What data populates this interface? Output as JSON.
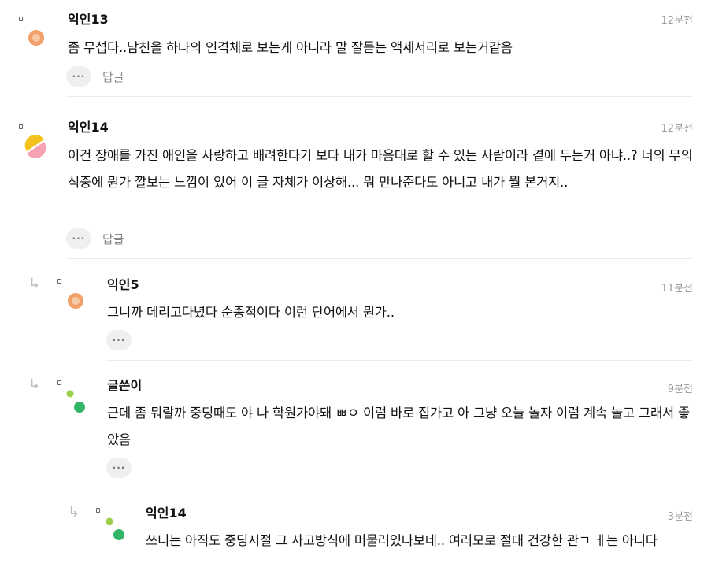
{
  "comments": [
    {
      "author": "익인13",
      "time": "12분전",
      "text": "좀 무섭다..남친을 하나의 인격체로 보는게 아니라 말 잘듣는 액세서리로 보는거같음",
      "reply_label": "답글",
      "more_label": "···",
      "avatar": {
        "type": "ring",
        "colors": [
          "#f2a06a",
          "#f6c9a6"
        ]
      }
    },
    {
      "author": "익인14",
      "time": "12분전",
      "text": "이건 장애를 가진 애인을 사랑하고 배려한다기 보다 내가 마음대로 할 수 있는 사람이라 곁에 두는거 아냐..? 너의 무의식중에 뭔가 깔보는 느낌이 있어 이 글 자체가 이상해... 뭐 만나준다도 아니고 내가 뭘 본거지..",
      "reply_label": "답글",
      "more_label": "···",
      "avatar": {
        "type": "halves",
        "colors": [
          "#f4c21e",
          "#f5a3b4"
        ]
      }
    },
    {
      "author": "익인5",
      "time": "11분전",
      "text": "그니까 데리고다녔다 순종적이다 이런 단어에서 뭔가..",
      "more_label": "···",
      "avatar": {
        "type": "ring",
        "colors": [
          "#f2a06a",
          "#f6c9a6"
        ]
      }
    },
    {
      "author": "글쓴이",
      "time": "9분전",
      "text": "근데 좀 뭐랄까 중딩때도 야 나 학원가야돼 ㅃㅇ 이럼 바로 집가고 아 그냥 오늘 놀자 이럼 계속 놀고 그래서 좋았음",
      "more_label": "···",
      "avatar": {
        "type": "dots",
        "colors": [
          "#9bcf4a",
          "#33b567"
        ]
      }
    },
    {
      "author": "익인14",
      "time": "3분전",
      "text": "쓰니는 아직도 중딩시절 그 사고방식에 머물러있나보네.. 여러모로 절대 건강한 관ㄱ ㅔ는 아니다",
      "avatar": {
        "type": "dots",
        "colors": [
          "#9bcf4a",
          "#33b567"
        ]
      }
    }
  ],
  "reply_icon": "reply-arrow-icon"
}
